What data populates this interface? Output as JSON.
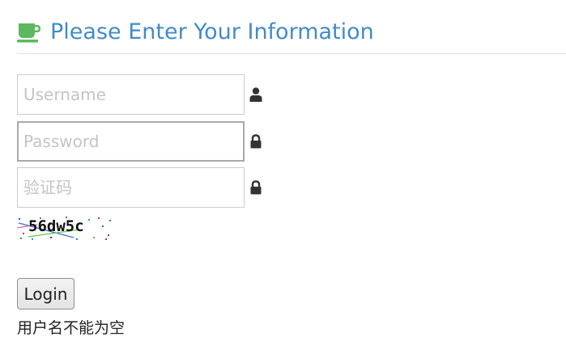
{
  "header": {
    "title": "Please Enter Your Information",
    "icon": "coffee-cup-icon",
    "title_color": "#428bca",
    "icon_color": "#5cb85c"
  },
  "form": {
    "username": {
      "value": "",
      "placeholder": "Username",
      "icon": "user-icon"
    },
    "password": {
      "value": "",
      "placeholder": "Password",
      "icon": "lock-icon"
    },
    "captcha_input": {
      "value": "",
      "placeholder": "验证码",
      "icon": "lock-icon"
    },
    "captcha_image": {
      "text": "56dw5c"
    },
    "login_label": "Login",
    "error_message": "用户名不能为空"
  }
}
